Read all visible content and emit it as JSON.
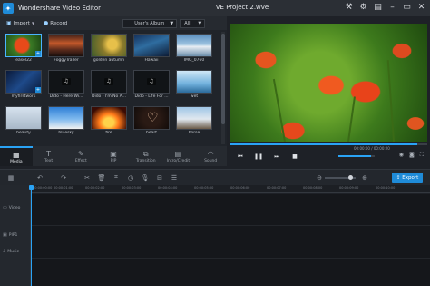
{
  "window": {
    "app_title": "Wondershare Video Editor",
    "project_title": "VE Project 2.wve",
    "controls": [
      "tools-icon",
      "gear-icon",
      "cart-icon",
      "minimize-icon",
      "maximize-icon",
      "close-icon"
    ]
  },
  "library_toolbar": {
    "import_label": "Import",
    "record_label": "Record",
    "album_select": "User's Album",
    "filter_select": "All"
  },
  "media": [
    {
      "label": "easel22",
      "selected": true
    },
    {
      "label": "FoggyTrailer",
      "selected": false
    },
    {
      "label": "golden autumn",
      "selected": false
    },
    {
      "label": "Hawaii",
      "selected": false
    },
    {
      "label": "IMG_0760",
      "selected": false
    },
    {
      "label": "myfirstwork",
      "selected": false
    },
    {
      "label": "Dido - Here Wi...",
      "selected": false
    },
    {
      "label": "Dido - I'm No A...",
      "selected": false
    },
    {
      "label": "Dido - Life For ...",
      "selected": false
    },
    {
      "label": "wet",
      "selected": false
    },
    {
      "label": "beauty",
      "selected": false
    },
    {
      "label": "bluesky",
      "selected": false
    },
    {
      "label": "fire",
      "selected": false
    },
    {
      "label": "heart",
      "selected": false
    },
    {
      "label": "horse",
      "selected": false
    }
  ],
  "tabs": [
    {
      "label": "Media",
      "icon": "film-icon",
      "active": true
    },
    {
      "label": "Text",
      "icon": "text-icon",
      "active": false
    },
    {
      "label": "Effect",
      "icon": "magic-icon",
      "active": false
    },
    {
      "label": "PIP",
      "icon": "pip-icon",
      "active": false
    },
    {
      "label": "Transition",
      "icon": "transition-icon",
      "active": false
    },
    {
      "label": "Intro/Credit",
      "icon": "intro-icon",
      "active": false
    },
    {
      "label": "Sound",
      "icon": "headphones-icon",
      "active": false
    }
  ],
  "player": {
    "time": "00:00:00 / 00:00:20",
    "progress_fraction": 0.95,
    "volume_fraction": 0.9
  },
  "timeline": {
    "export_label": "Export",
    "ruler_labels": [
      "00:00:00:00",
      "00:00:01:00",
      "00:00:02:00",
      "00:00:03:00",
      "00:00:04:00",
      "00:00:05:00",
      "00:00:06:00",
      "00:00:07:00",
      "00:00:08:00",
      "00:00:09:00",
      "00:00:10:00"
    ],
    "tracks": [
      {
        "label": "Video",
        "icon": "video-track-icon"
      },
      {
        "label": "PIP1",
        "icon": "pip-track-icon"
      },
      {
        "label": "Music",
        "icon": "music-note-icon"
      }
    ]
  },
  "colors": {
    "accent": "#2aa3f5",
    "export": "#1f8bd8",
    "background": "#1e2127"
  }
}
